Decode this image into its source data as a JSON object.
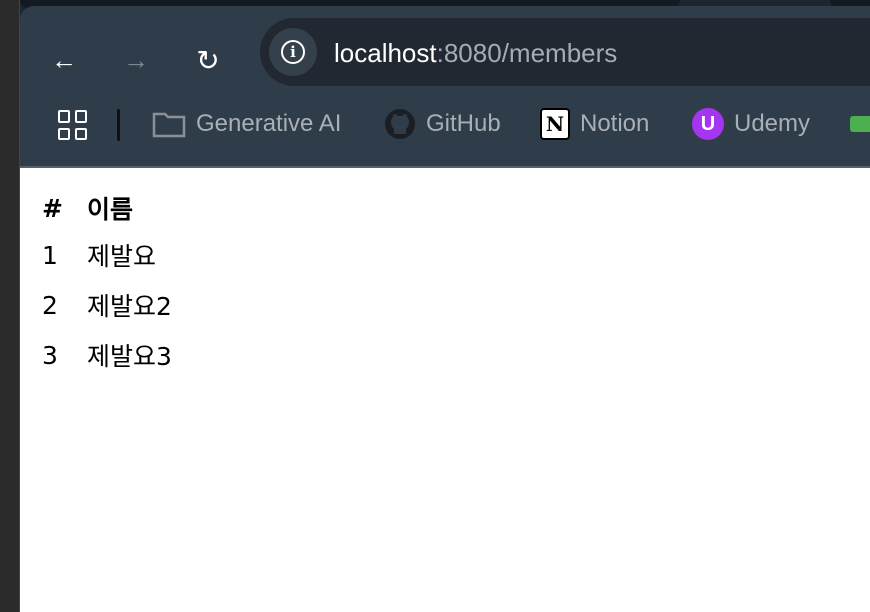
{
  "browser": {
    "url_host": "localhost",
    "url_rest": ":8080/members",
    "bookmarks": [
      {
        "label": "Generative AI",
        "icon": "folder-icon"
      },
      {
        "label": "GitHub",
        "icon": "github-icon"
      },
      {
        "label": "Notion",
        "icon": "notion-icon"
      },
      {
        "label": "Udemy",
        "icon": "udemy-icon"
      }
    ],
    "colors": {
      "toolbar": "#2f3d4a",
      "omnibox": "#222831",
      "udemy": "#a435f0"
    }
  },
  "table": {
    "headers": [
      "#",
      "이름"
    ],
    "rows": [
      [
        "1",
        "제발요"
      ],
      [
        "2",
        "제발요2"
      ],
      [
        "3",
        "제발요3"
      ]
    ]
  }
}
